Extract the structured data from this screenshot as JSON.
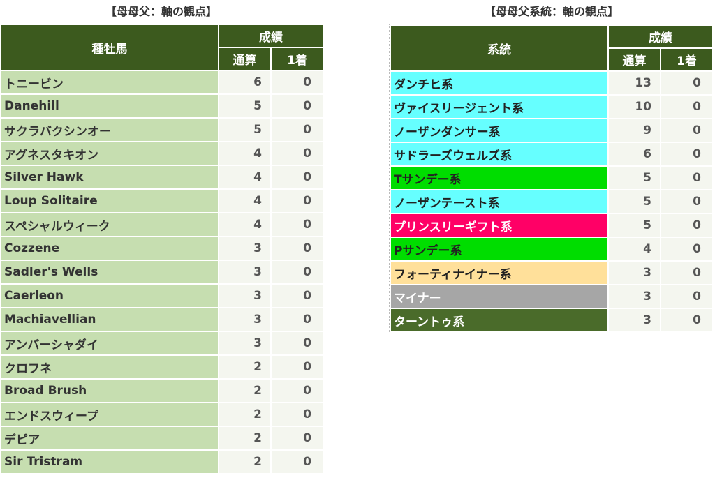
{
  "left": {
    "title": "【母母父：軸の観点】",
    "headers": {
      "main": "種牡馬",
      "group": "成績",
      "total": "通算",
      "first": "1着"
    },
    "rows": [
      {
        "name": "トニービン",
        "total": "6",
        "first": "0"
      },
      {
        "name": "Danehill",
        "total": "5",
        "first": "0"
      },
      {
        "name": "サクラバクシンオー",
        "total": "5",
        "first": "0"
      },
      {
        "name": "アグネスタキオン",
        "total": "4",
        "first": "0"
      },
      {
        "name": "Silver Hawk",
        "total": "4",
        "first": "0"
      },
      {
        "name": "Loup Solitaire",
        "total": "4",
        "first": "0"
      },
      {
        "name": "スペシャルウィーク",
        "total": "4",
        "first": "0"
      },
      {
        "name": "Cozzene",
        "total": "3",
        "first": "0"
      },
      {
        "name": "Sadler's Wells",
        "total": "3",
        "first": "0"
      },
      {
        "name": "Caerleon",
        "total": "3",
        "first": "0"
      },
      {
        "name": "Machiavellian",
        "total": "3",
        "first": "0"
      },
      {
        "name": "アンバーシャダイ",
        "total": "3",
        "first": "0"
      },
      {
        "name": "クロフネ",
        "total": "2",
        "first": "0"
      },
      {
        "name": "Broad Brush",
        "total": "2",
        "first": "0"
      },
      {
        "name": "エンドスウィープ",
        "total": "2",
        "first": "0"
      },
      {
        "name": "デピア",
        "total": "2",
        "first": "0"
      },
      {
        "name": "Sir Tristram",
        "total": "2",
        "first": "0"
      }
    ]
  },
  "right": {
    "title": "【母母父系統：軸の観点】",
    "headers": {
      "main": "系統",
      "group": "成績",
      "total": "通算",
      "first": "1着"
    },
    "rows": [
      {
        "name": "ダンチヒ系",
        "total": "13",
        "first": "0",
        "bg": "#66ffff",
        "fg": "#222222"
      },
      {
        "name": "ヴァイスリージェント系",
        "total": "10",
        "first": "0",
        "bg": "#66ffff",
        "fg": "#222222"
      },
      {
        "name": "ノーザンダンサー系",
        "total": "9",
        "first": "0",
        "bg": "#66ffff",
        "fg": "#222222"
      },
      {
        "name": "サドラーズウェルズ系",
        "total": "6",
        "first": "0",
        "bg": "#66ffff",
        "fg": "#222222"
      },
      {
        "name": "Tサンデー系",
        "total": "5",
        "first": "0",
        "bg": "#00dd00",
        "fg": "#222222"
      },
      {
        "name": "ノーザンテースト系",
        "total": "5",
        "first": "0",
        "bg": "#66ffff",
        "fg": "#222222"
      },
      {
        "name": "プリンスリーギフト系",
        "total": "5",
        "first": "0",
        "bg": "#ff0066",
        "fg": "#ffffff"
      },
      {
        "name": "Pサンデー系",
        "total": "4",
        "first": "0",
        "bg": "#00dd00",
        "fg": "#222222"
      },
      {
        "name": "フォーティナイナー系",
        "total": "3",
        "first": "0",
        "bg": "#ffe09a",
        "fg": "#222222"
      },
      {
        "name": "マイナー",
        "total": "3",
        "first": "0",
        "bg": "#a6a6a6",
        "fg": "#ffffff"
      },
      {
        "name": "ターントゥ系",
        "total": "3",
        "first": "0",
        "bg": "#4a6b2a",
        "fg": "#ffffff"
      }
    ]
  }
}
